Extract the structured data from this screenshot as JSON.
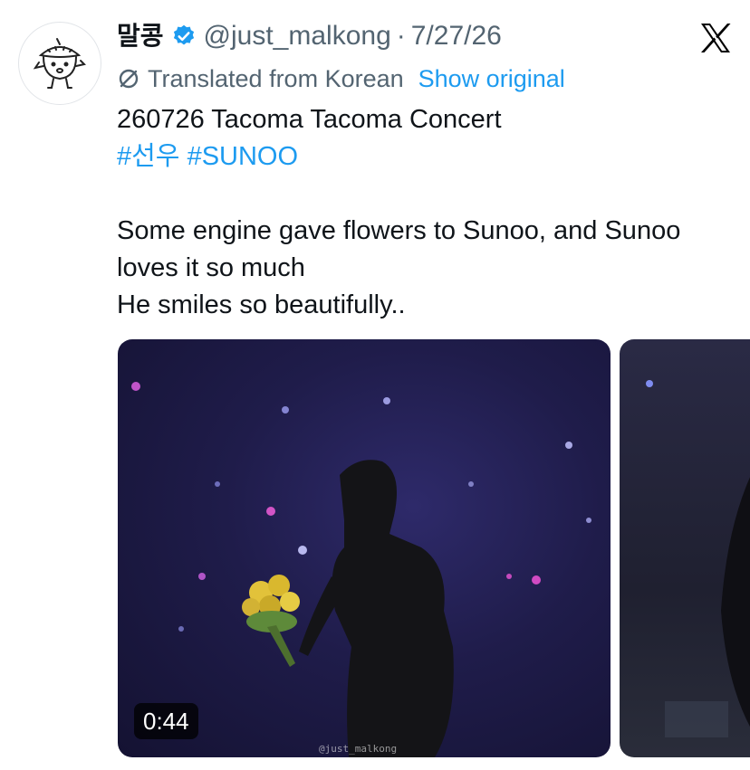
{
  "author": {
    "display_name": "말콩",
    "handle": "@just_malkong",
    "separator": "·",
    "date": "7/27/26",
    "verified": true,
    "avatar_icon": "acorn-character-icon"
  },
  "platform_logo": "x-logo-icon",
  "translation": {
    "label": "Translated from Korean",
    "action": "Show original"
  },
  "tweet": {
    "line1": "260726 Tacoma Tacoma Concert",
    "hashtags": [
      "#선우",
      "#SUNOO"
    ],
    "line2": "Some engine gave flowers to Sunoo, and Sunoo",
    "line3": "loves it so much",
    "line4": "He smiles so beautifully.."
  },
  "media": [
    {
      "type": "video",
      "duration": "0:44",
      "watermark": "@just_malkong"
    },
    {
      "type": "image"
    }
  ],
  "colors": {
    "accent": "#1d9bf0",
    "text": "#0f1419",
    "secondary_text": "#536471"
  }
}
